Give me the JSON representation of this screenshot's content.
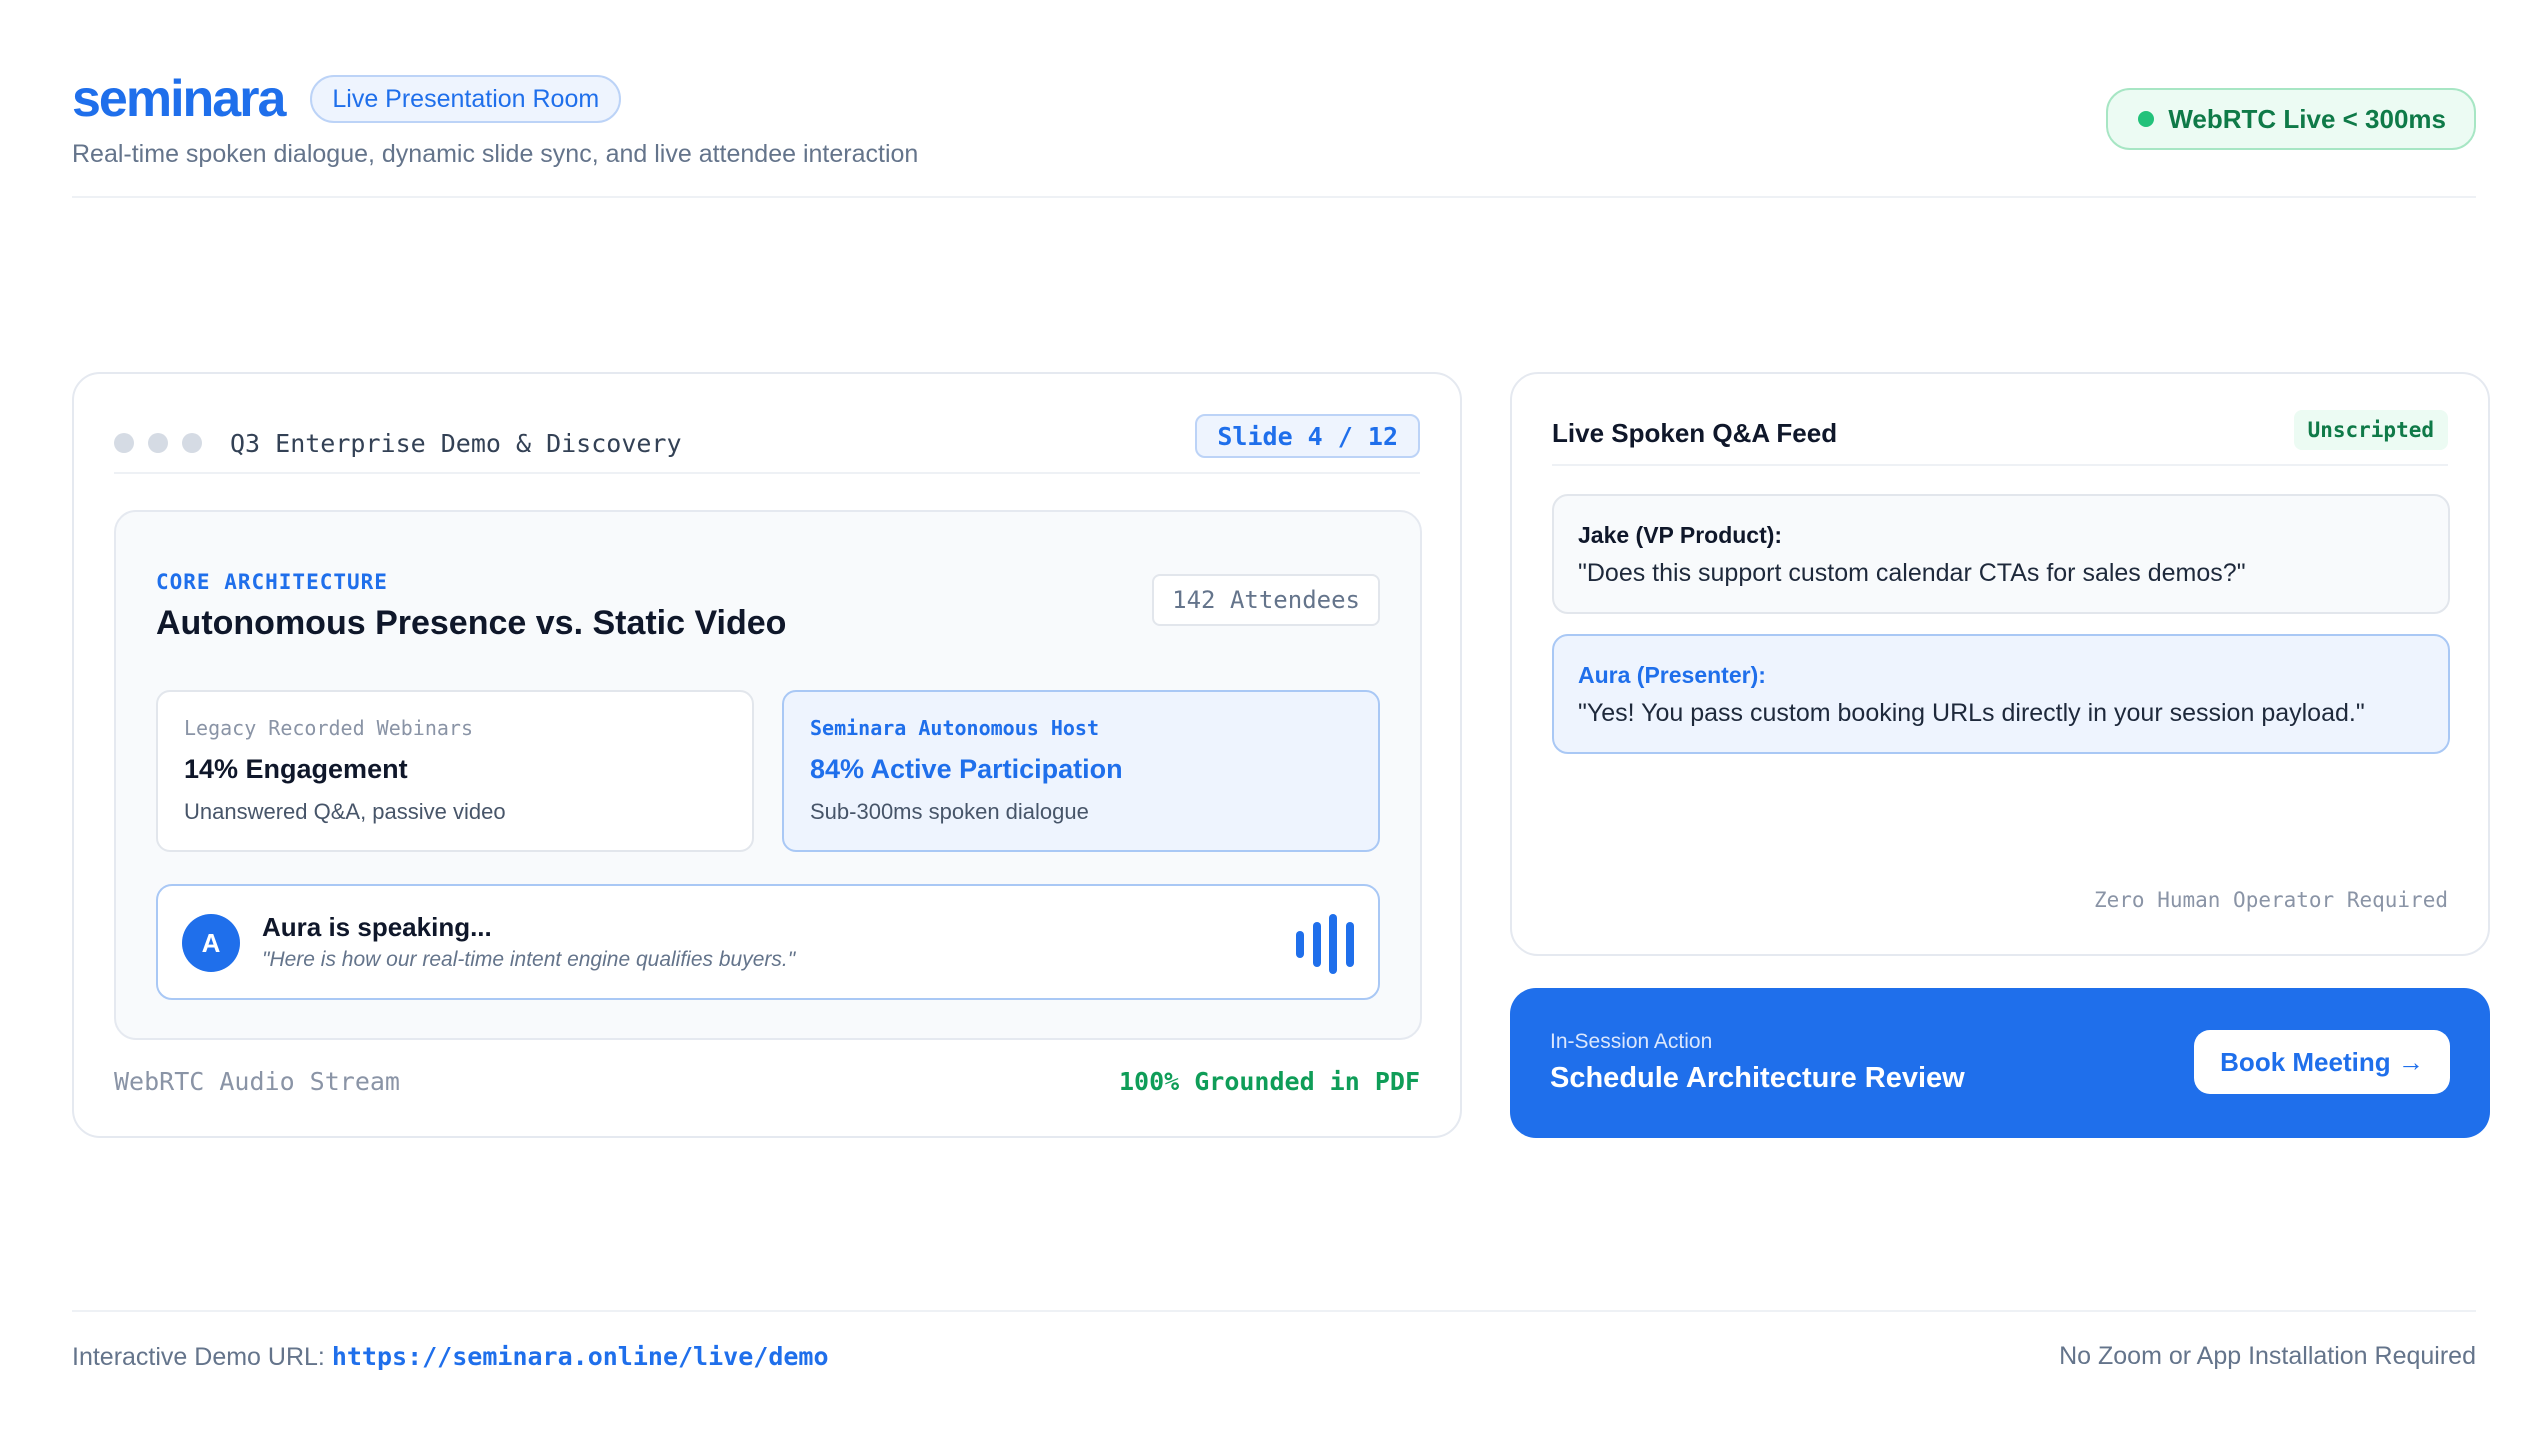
{
  "header": {
    "logo": "seminara",
    "room_label": "Live Presentation Room",
    "subtitle": "Real-time spoken dialogue, dynamic slide sync, and live attendee interaction",
    "status_label": "WebRTC Live < 300ms"
  },
  "slide_panel": {
    "deck_title": "Q3 Enterprise Demo & Discovery",
    "slide_counter": "Slide 4 / 12",
    "slide": {
      "eyebrow": "CORE ARCHITECTURE",
      "heading": "Autonomous Presence vs. Static Video",
      "attendees": "142 Attendees",
      "cards": [
        {
          "label": "Legacy Recorded Webinars",
          "metric": "14% Engagement",
          "note": "Unanswered Q&A, passive video"
        },
        {
          "label": "Seminara Autonomous Host",
          "metric": "84% Active Participation",
          "note": "Sub-300ms spoken dialogue"
        }
      ],
      "speaking": {
        "avatar": "A",
        "title": "Aura is speaking...",
        "quote": "\"Here is how our real-time intent engine qualifies buyers.\"",
        "wave_levels": [
          0.45,
          0.75,
          1.0,
          0.75
        ]
      }
    },
    "footer_left": "WebRTC Audio Stream",
    "footer_right": "100% Grounded in PDF"
  },
  "qa_panel": {
    "title": "Live Spoken Q&A Feed",
    "badge": "Unscripted",
    "messages": [
      {
        "name": "Jake (VP Product):",
        "text": "\"Does this support custom calendar CTAs for sales demos?\""
      },
      {
        "name": "Aura (Presenter):",
        "text": "\"Yes! You pass custom booking URLs directly in your session payload.\""
      }
    ],
    "footer": "Zero Human Operator Required"
  },
  "action": {
    "kicker": "In-Session Action",
    "title": "Schedule Architecture Review",
    "button_label": "Book Meeting →"
  },
  "footer": {
    "url_label": "Interactive Demo URL:",
    "url": "https://seminara.online/live/demo",
    "right_note": "No Zoom or App Installation Required"
  },
  "colors": {
    "accent": "#1f6feb",
    "live_green": "#22c27a",
    "grounded_green": "#0f9d58"
  }
}
